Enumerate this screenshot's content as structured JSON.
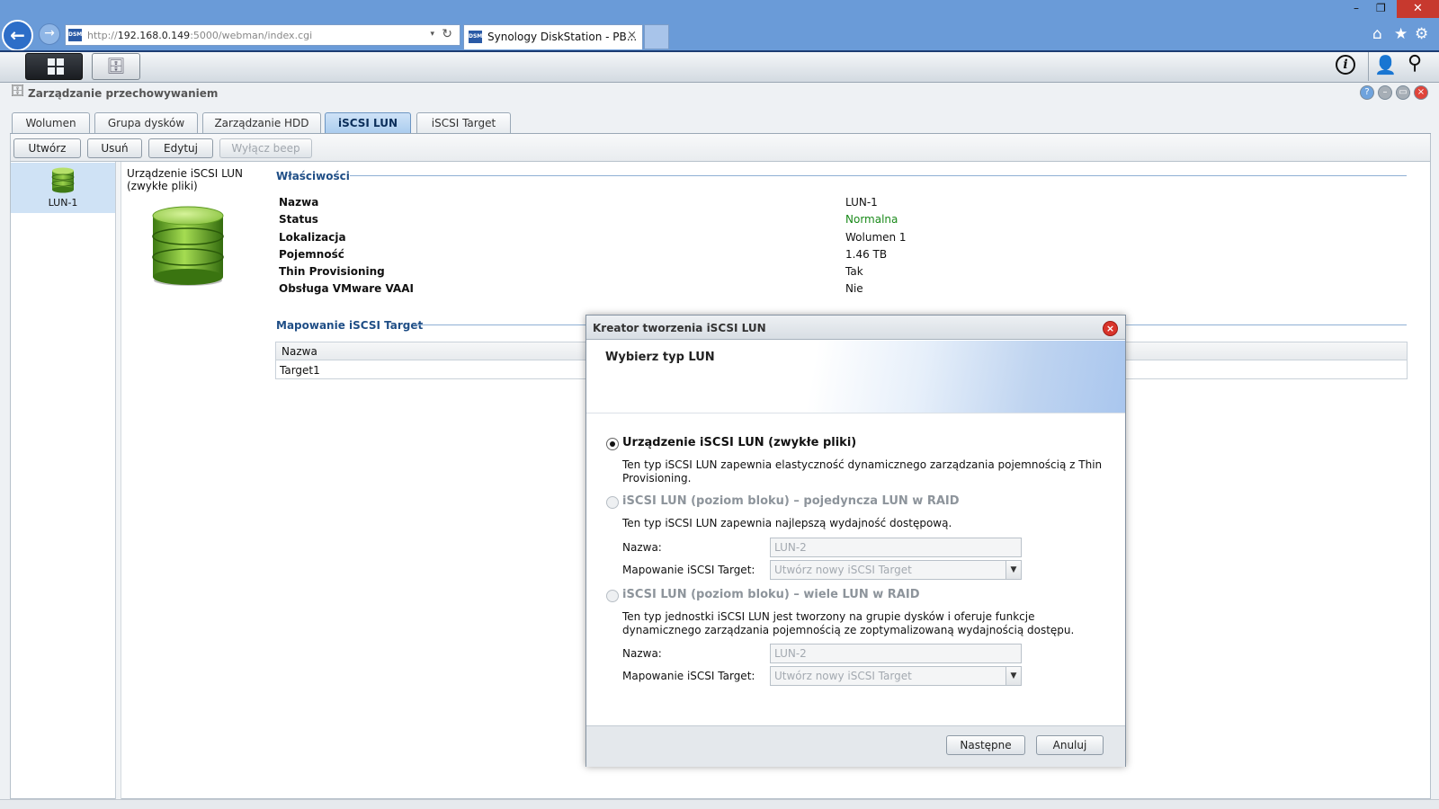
{
  "browser": {
    "url_prefix": "http://",
    "url_host": "192.168.0.149",
    "url_rest": ":5000/webman/index.cgi",
    "favicon_text": "DSM",
    "tab_title": "Synology DiskStation - PB...",
    "close_glyph": "×",
    "back_glyph": "←",
    "forward_glyph": "→",
    "dropdown_glyph": "▾",
    "refresh_glyph": "↻",
    "min_glyph": "–",
    "max_glyph": "❐",
    "close_window_glyph": "✕",
    "home_glyph": "⌂",
    "star_glyph": "★",
    "gear_glyph": "⚙"
  },
  "taskbar": {
    "info_glyph": "i",
    "user_glyph": "👤",
    "search_glyph": "⚲"
  },
  "app": {
    "title": "Zarządzanie przechowywaniem",
    "title_icon_glyph": "🗄",
    "help_glyph": "?",
    "min_glyph": "–",
    "max_glyph": "▭",
    "close_glyph": "×",
    "tabs": [
      {
        "label": "Wolumen"
      },
      {
        "label": "Grupa dysków"
      },
      {
        "label": "Zarządzanie HDD"
      },
      {
        "label": "iSCSI LUN"
      },
      {
        "label": "iSCSI Target"
      }
    ],
    "active_tab": "iSCSI LUN",
    "toolbar": {
      "create": "Utwórz",
      "delete": "Usuń",
      "edit": "Edytuj",
      "beep_off": "Wyłącz beep"
    },
    "lun_list": [
      {
        "label": "LUN-1"
      }
    ],
    "type_label": "Urządzenie iSCSI LUN (zwykłe pliki)",
    "properties_title": "Właściwości",
    "properties": [
      {
        "key": "Nazwa",
        "value": "LUN-1"
      },
      {
        "key": "Status",
        "value": "Normalna"
      },
      {
        "key": "Lokalizacja",
        "value": "Wolumen 1"
      },
      {
        "key": "Pojemność",
        "value": "1.46 TB"
      },
      {
        "key": "Thin Provisioning",
        "value": "Tak"
      },
      {
        "key": "Obsługa VMware VAAI",
        "value": "Nie"
      }
    ],
    "mapping_title": "Mapowanie iSCSI Target",
    "mapping_table": {
      "columns": [
        "Nazwa"
      ],
      "rows": [
        [
          "Target1"
        ]
      ]
    }
  },
  "dialog": {
    "title": "Kreator tworzenia iSCSI LUN",
    "close_glyph": "×",
    "step_title": "Wybierz typ LUN",
    "options": [
      {
        "label": "Urządzenie iSCSI LUN (zwykłe pliki)",
        "desc": "Ten typ iSCSI LUN zapewnia elastyczność dynamicznego zarządzania pojemnością z Thin Provisioning.",
        "selected": true
      },
      {
        "label": "iSCSI LUN (poziom bloku) – pojedyncza LUN w RAID",
        "desc": "Ten typ iSCSI LUN zapewnia najlepszą wydajność dostępową.",
        "name_label": "Nazwa:",
        "name_value": "LUN-2",
        "map_label": "Mapowanie iSCSI Target:",
        "map_value": "Utwórz nowy iSCSI Target",
        "selected": false
      },
      {
        "label": "iSCSI LUN (poziom bloku) – wiele LUN w RAID",
        "desc": "Ten typ jednostki iSCSI LUN jest tworzony na grupie dysków i oferuje funkcje dynamicznego zarządzania pojemnością ze zoptymalizowaną wydajnością dostępu.",
        "name_label": "Nazwa:",
        "name_value": "LUN-2",
        "map_label": "Mapowanie iSCSI Target:",
        "map_value": "Utwórz nowy iSCSI Target",
        "selected": false
      }
    ],
    "select_arrow_glyph": "▼",
    "next": "Następne",
    "cancel": "Anuluj"
  },
  "colors": {
    "browser_bar": "#6a9bd8",
    "active_tab": "#a9cbee",
    "status_ok": "#1a8a1a",
    "section_title": "#1f4e86",
    "close_red": "#d9342b"
  }
}
